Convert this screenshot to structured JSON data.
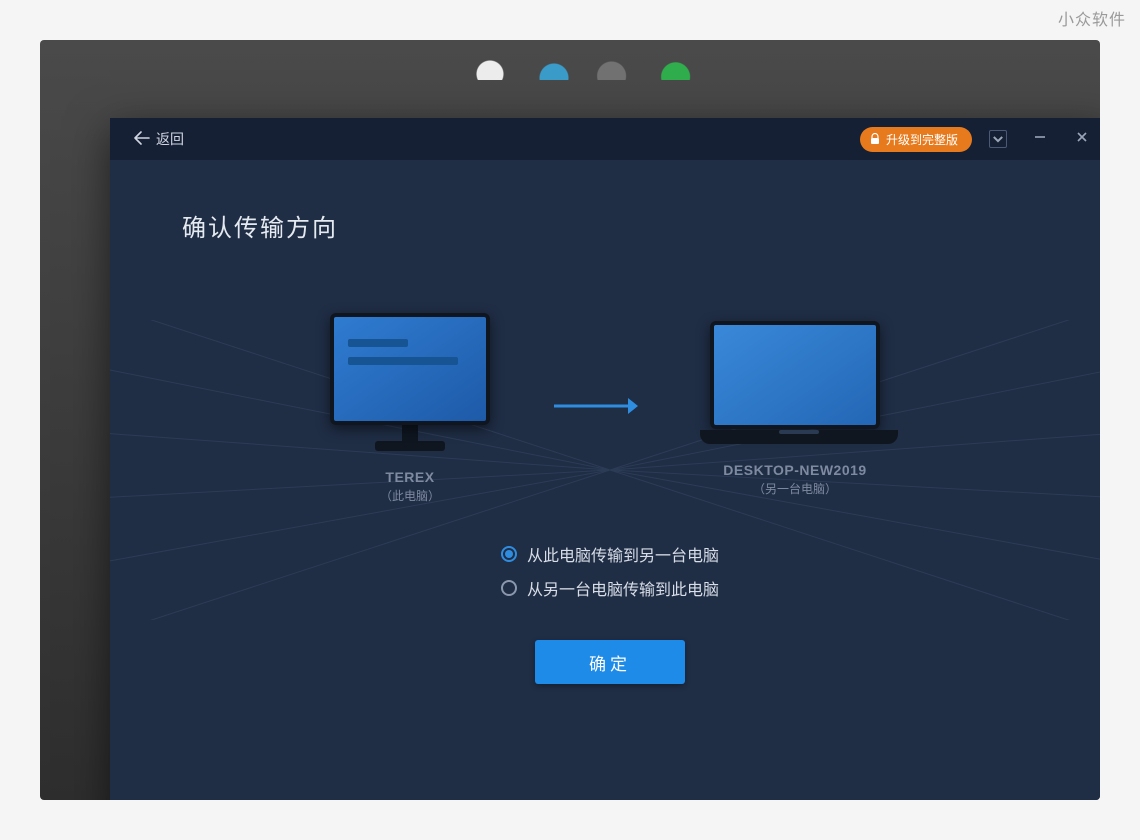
{
  "watermark": "小众软件",
  "titlebar": {
    "back_label": "返回",
    "upgrade_label": "升级到完整版"
  },
  "page": {
    "title": "确认传输方向"
  },
  "devices": {
    "source": {
      "name": "TEREX",
      "subtitle": "（此电脑）"
    },
    "target": {
      "name": "DESKTOP-NEW2019",
      "subtitle": "（另一台电脑）"
    }
  },
  "options": {
    "to_other": "从此电脑传输到另一台电脑",
    "from_other": "从另一台电脑传输到此电脑",
    "selected": "to_other"
  },
  "buttons": {
    "confirm": "确定"
  }
}
